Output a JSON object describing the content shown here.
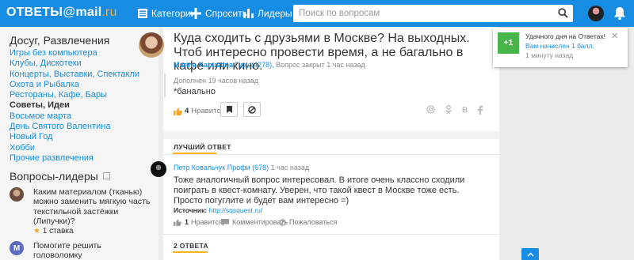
{
  "header": {
    "logo_main": "ОТВЕТЫ",
    "logo_at": "@",
    "logo_mail": "mail",
    "logo_ru": ".ru",
    "nav": {
      "categories": "Категории",
      "ask": "Спросить",
      "leaders": "Лидеры"
    },
    "search_placeholder": "Поиск по вопросам"
  },
  "sidebar": {
    "category_title": "Досуг, Развлечения",
    "categories": [
      {
        "label": "Игры без компьютера"
      },
      {
        "label": "Клубы, Дискотеки"
      },
      {
        "label": "Концерты, Выставки, Спектакли"
      },
      {
        "label": "Охота и Рыбалка"
      },
      {
        "label": "Рестораны, Кафе, Бары"
      },
      {
        "label": "Советы, Идеи"
      },
      {
        "label": "Восьмое марта"
      },
      {
        "label": "День Святого Валентина"
      },
      {
        "label": "Новый Год"
      },
      {
        "label": "Хобби"
      },
      {
        "label": "Прочие развлечения"
      }
    ],
    "active_category_index": 5,
    "leaders_title": "Вопросы-лидеры",
    "leader_questions": [
      {
        "text": "Каким материалом (тканью) можно заменить мягкую часть текстильной застёжки (Липучки)?",
        "rating": "1 ставка"
      },
      {
        "text": "Помогите решить головоломку",
        "avatar_letter": "M"
      }
    ]
  },
  "question": {
    "title": "Куда сходить с друзьями в Москве? На выходных. Чтоб интересно провести время, а не багально в кафе или кино.",
    "author": "Marina Kapustina",
    "rank": "Гуру (4278),",
    "status": "Вопрос закрыт 1 час назад",
    "added_when": "Дополнен 19 часов назад",
    "added_text": "*банально",
    "likes_count": "4",
    "likes_label": "Нравится"
  },
  "best_answer": {
    "section_label": "ЛУЧШИЙ ОТВЕТ",
    "author": "Петр Ковальчук",
    "rank": "Профи (678)",
    "time": "1 час назад",
    "text": "Тоже аналогичный вопрос интересовал. В итоге очень классно сходили поиграть в квест-комнату. Уверен, что такой квест в Москве тоже есть. Просто погуглите и будет вам интересно =)",
    "source_label": "Источник:",
    "source_link": "http://sqsquest.ru/",
    "likes_count": "1",
    "likes_label": "Нравится",
    "comment_label": "Комментировать",
    "complain_label": "Пожаловаться"
  },
  "answers_section_label": "2 ОТВЕТА",
  "notification": {
    "badge": "+1",
    "title": "Удачного дня на Ответах!",
    "message": "Вам начислен 1 балл.",
    "time": "1 минуту назад"
  },
  "colors": {
    "brand_blue": "#168de2",
    "accent_orange": "#ffb21b",
    "success_green": "#46b648"
  }
}
